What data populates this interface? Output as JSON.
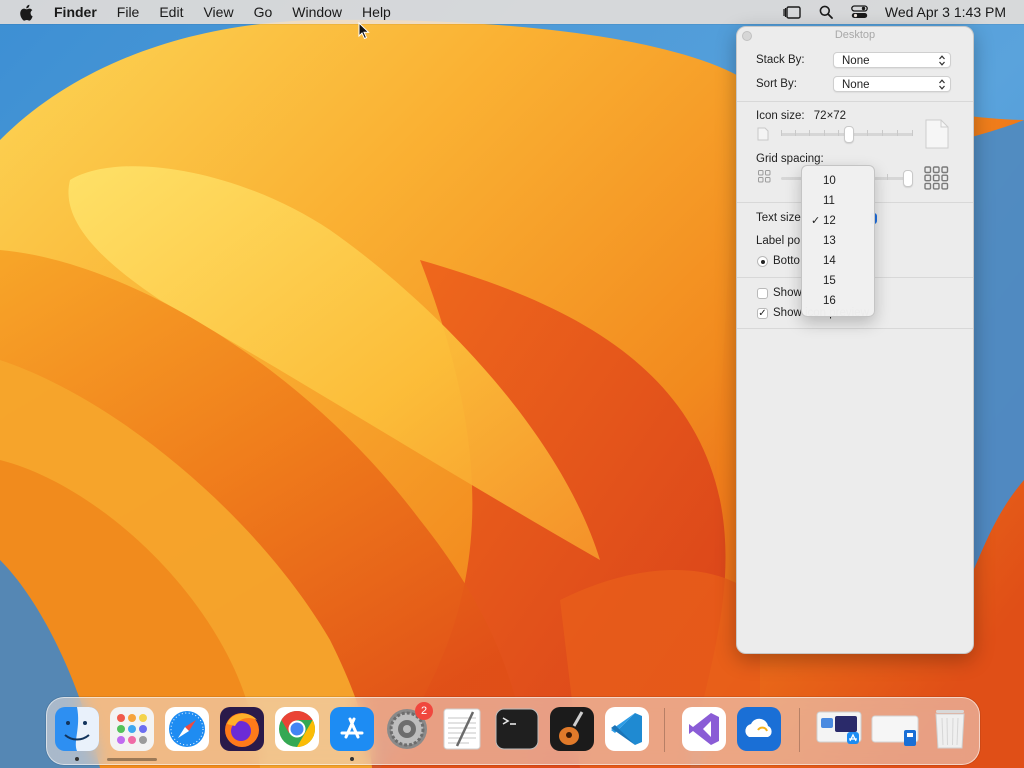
{
  "menubar": {
    "app_name": "Finder",
    "menus": [
      "File",
      "Edit",
      "View",
      "Go",
      "Window",
      "Help"
    ],
    "clock": "Wed Apr 3  1:43 PM",
    "status_icons": [
      "stage-manager-icon",
      "spotlight-icon",
      "control-center-icon"
    ]
  },
  "panel": {
    "title": "Desktop",
    "stack_by_label": "Stack By:",
    "stack_by_value": "None",
    "sort_by_label": "Sort By:",
    "sort_by_value": "None",
    "icon_size_label": "Icon size:",
    "icon_size_value": "72×72",
    "grid_spacing_label": "Grid spacing:",
    "text_size_label": "Text size",
    "label_position_label": "Label po",
    "label_position_bottom": "Botto",
    "show_item_info_label": "Show",
    "show_item_info_checked": false,
    "show_icon_preview_label": "Show icon preview",
    "show_icon_preview_checked": true
  },
  "text_size_menu": {
    "options": [
      "10",
      "11",
      "12",
      "13",
      "14",
      "15",
      "16"
    ],
    "selected": "12"
  },
  "dock": {
    "apps": [
      "Finder",
      "Launchpad",
      "Safari",
      "Firefox",
      "Google Chrome",
      "App Store",
      "System Settings",
      "TextEdit",
      "Terminal",
      "GarageBand",
      "Visual Studio Code",
      "Visual Studio",
      "CloudMounter"
    ],
    "system_settings_badge": "2",
    "right_items": [
      "Applications stack",
      "Downloads stack",
      "Trash"
    ]
  },
  "colors": {
    "wallpaper_orange": "#f08a1c",
    "wallpaper_yellow": "#fbc63c",
    "wallpaper_blue": "#3d8fd3",
    "menubar_bg": "#ece2da",
    "panel_bg": "#ececec",
    "accent_blue": "#1f6fe0",
    "badge_red": "#f0473e"
  }
}
